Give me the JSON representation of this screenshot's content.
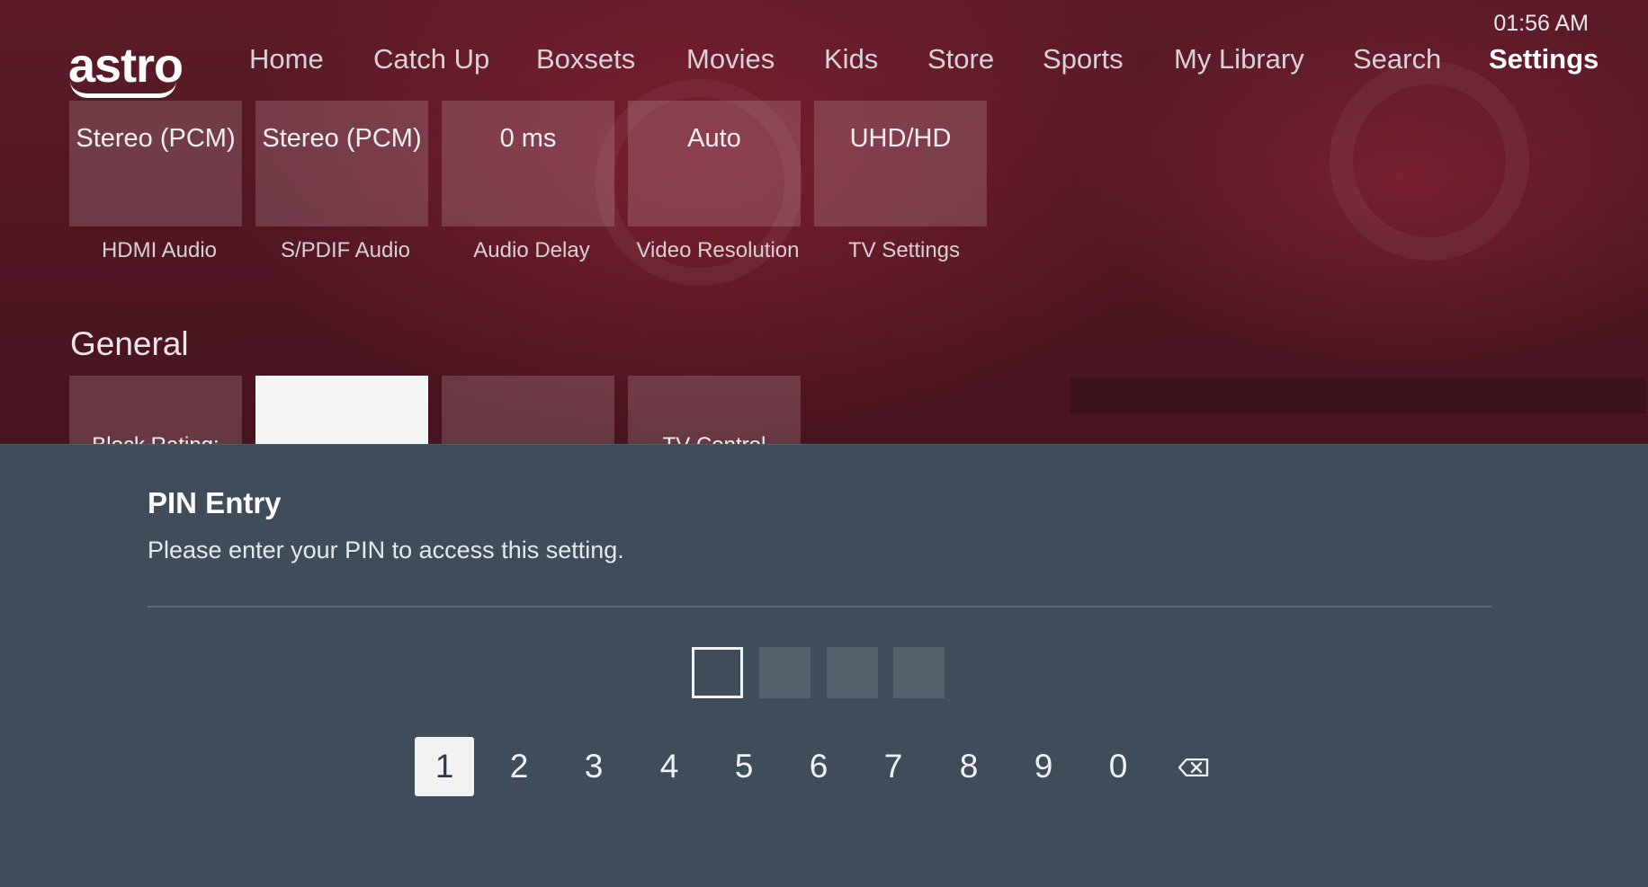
{
  "status": {
    "time": "01:56 AM"
  },
  "brand": {
    "logo_text": "astro"
  },
  "nav": {
    "items": [
      {
        "label": "Home",
        "active": false
      },
      {
        "label": "Catch Up",
        "active": false
      },
      {
        "label": "Boxsets",
        "active": false
      },
      {
        "label": "Movies",
        "active": false
      },
      {
        "label": "Kids",
        "active": false
      },
      {
        "label": "Store",
        "active": false
      },
      {
        "label": "Sports",
        "active": false
      },
      {
        "label": "My Library",
        "active": false
      },
      {
        "label": "Search",
        "active": false
      },
      {
        "label": "Settings",
        "active": true
      }
    ]
  },
  "av_settings": {
    "tiles": [
      {
        "value": "Stereo (PCM)",
        "label": "HDMI Audio"
      },
      {
        "value": "Stereo (PCM)",
        "label": "S/PDIF Audio"
      },
      {
        "value": "0 ms",
        "label": "Audio Delay"
      },
      {
        "value": "Auto",
        "label": "Video Resolution"
      },
      {
        "value": "UHD/HD",
        "label": "TV Settings"
      }
    ]
  },
  "general": {
    "title": "General",
    "tiles": [
      {
        "value": "Block Rating:",
        "focused": false
      },
      {
        "value": "",
        "focused": true
      },
      {
        "value": "",
        "focused": false
      },
      {
        "value": "TV Control",
        "focused": false
      }
    ]
  },
  "pin_dialog": {
    "title": "PIN Entry",
    "message": "Please enter your PIN to access this setting.",
    "digits_entered": 0,
    "pin_length": 4,
    "keypad": [
      "1",
      "2",
      "3",
      "4",
      "5",
      "6",
      "7",
      "8",
      "9",
      "0"
    ],
    "focused_key": "1",
    "backspace_icon": "backspace-icon"
  },
  "colors": {
    "dialog_bg": "#3f4d5a",
    "focus": "#f2f2f2",
    "header_bg": "#4a1520"
  }
}
